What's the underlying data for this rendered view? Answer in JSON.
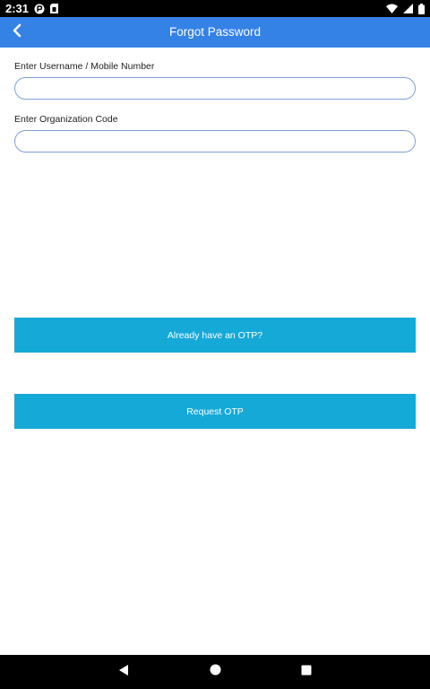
{
  "status_bar": {
    "time": "2:31",
    "icons": [
      "notification-app-icon",
      "sim-card-icon",
      "wifi-icon",
      "signal-icon",
      "battery-icon"
    ]
  },
  "app_bar": {
    "title": "Forgot Password",
    "back_icon": "chevron-left-icon",
    "color": "#3482e6"
  },
  "form": {
    "username_label": "Enter Username / Mobile Number",
    "username_value": "",
    "org_label": "Enter Organization Code",
    "org_value": ""
  },
  "buttons": {
    "otp_label": "Already have an OTP?",
    "request_label": "Request OTP",
    "color": "#15a9d8"
  },
  "nav_bar": {
    "icons": [
      "back-triangle-icon",
      "home-circle-icon",
      "recents-square-icon"
    ]
  }
}
